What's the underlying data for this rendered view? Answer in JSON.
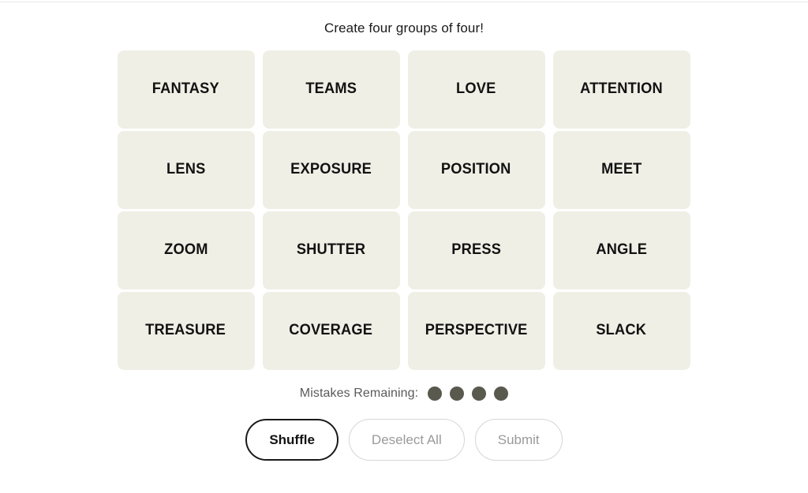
{
  "page": {
    "prompt": "Create four groups of four!",
    "background_color": "#FFFFFF"
  },
  "board": {
    "rows": 4,
    "columns": 4,
    "tile_color": "#EFEFE6",
    "tile_text_color": "#121212",
    "tiles": [
      {
        "label": "FANTASY",
        "row": 1,
        "col": 1,
        "selected": false
      },
      {
        "label": "TEAMS",
        "row": 1,
        "col": 2,
        "selected": false
      },
      {
        "label": "LOVE",
        "row": 1,
        "col": 3,
        "selected": false
      },
      {
        "label": "ATTENTION",
        "row": 1,
        "col": 4,
        "selected": false
      },
      {
        "label": "LENS",
        "row": 2,
        "col": 1,
        "selected": false
      },
      {
        "label": "EXPOSURE",
        "row": 2,
        "col": 2,
        "selected": false
      },
      {
        "label": "POSITION",
        "row": 2,
        "col": 3,
        "selected": false
      },
      {
        "label": "MEET",
        "row": 2,
        "col": 4,
        "selected": false
      },
      {
        "label": "ZOOM",
        "row": 3,
        "col": 1,
        "selected": false
      },
      {
        "label": "SHUTTER",
        "row": 3,
        "col": 2,
        "selected": false
      },
      {
        "label": "PRESS",
        "row": 3,
        "col": 3,
        "selected": false
      },
      {
        "label": "ANGLE",
        "row": 3,
        "col": 4,
        "selected": false
      },
      {
        "label": "TREASURE",
        "row": 4,
        "col": 1,
        "selected": false
      },
      {
        "label": "COVERAGE",
        "row": 4,
        "col": 2,
        "selected": false
      },
      {
        "label": "PERSPECTIVE",
        "row": 4,
        "col": 3,
        "selected": false
      },
      {
        "label": "SLACK",
        "row": 4,
        "col": 4,
        "selected": false
      }
    ]
  },
  "mistakes": {
    "label": "Mistakes Remaining:",
    "remaining": 4,
    "dot_color": "#5A594E",
    "dots": [
      {
        "icon": "filled-circle-icon"
      },
      {
        "icon": "filled-circle-icon"
      },
      {
        "icon": "filled-circle-icon"
      },
      {
        "icon": "filled-circle-icon"
      }
    ]
  },
  "actions": {
    "shuffle": {
      "label": "Shuffle",
      "enabled": true,
      "border_color": "#1A1A1A",
      "text_color": "#121212"
    },
    "deselect_all": {
      "label": "Deselect All",
      "enabled": false,
      "border_color": "#D6D6D6",
      "text_color": "#9A9A9A"
    },
    "submit": {
      "label": "Submit",
      "enabled": false,
      "border_color": "#D6D6D6",
      "text_color": "#9A9A9A"
    }
  }
}
